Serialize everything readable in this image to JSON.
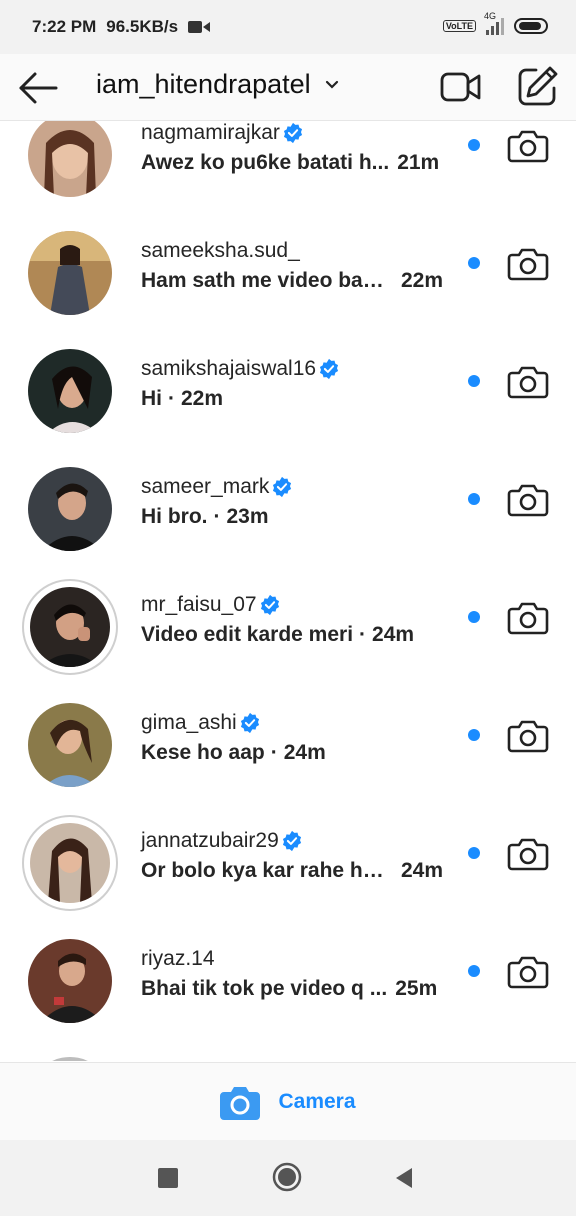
{
  "status_bar": {
    "time": "7:22 PM",
    "speed": "96.5KB/s",
    "network": "4G",
    "volte": "Vo LTE"
  },
  "header": {
    "title": "iam_hitendrapatel",
    "icons": [
      "back-arrow-icon",
      "chevron-down-icon",
      "video-call-icon",
      "new-message-icon"
    ]
  },
  "threads": [
    {
      "username": "nagmamirajkar",
      "verified": true,
      "message": "Awez ko pu6ke batati h...",
      "time": "21m",
      "unread": true,
      "story_ring": false
    },
    {
      "username": "sameeksha.sud_",
      "verified": false,
      "message": "Ham sath me video ban...",
      "time": "22m",
      "unread": true,
      "story_ring": false
    },
    {
      "username": "samikshajaiswal16",
      "verified": true,
      "message": "Hi",
      "time": "22m",
      "unread": true,
      "story_ring": false
    },
    {
      "username": "sameer_mark",
      "verified": true,
      "message": "Hi bro.",
      "time": "23m",
      "unread": true,
      "story_ring": false
    },
    {
      "username": "mr_faisu_07",
      "verified": true,
      "message": "Video edit karde meri",
      "time": "24m",
      "unread": true,
      "story_ring": true
    },
    {
      "username": "gima_ashi",
      "verified": true,
      "message": "Kese ho aap",
      "time": "24m",
      "unread": true,
      "story_ring": false
    },
    {
      "username": "jannatzubair29",
      "verified": true,
      "message": "Or bolo kya kar rahe ho...",
      "time": "24m",
      "unread": true,
      "story_ring": true
    },
    {
      "username": "riyaz.14",
      "verified": false,
      "message": "Bhai tik tok pe video q ...",
      "time": "25m",
      "unread": true,
      "story_ring": false
    }
  ],
  "camera_bar": {
    "label": "Camera"
  },
  "colors": {
    "accent": "#1a8cff",
    "verified": "#1a8cff",
    "text": "#262626"
  }
}
